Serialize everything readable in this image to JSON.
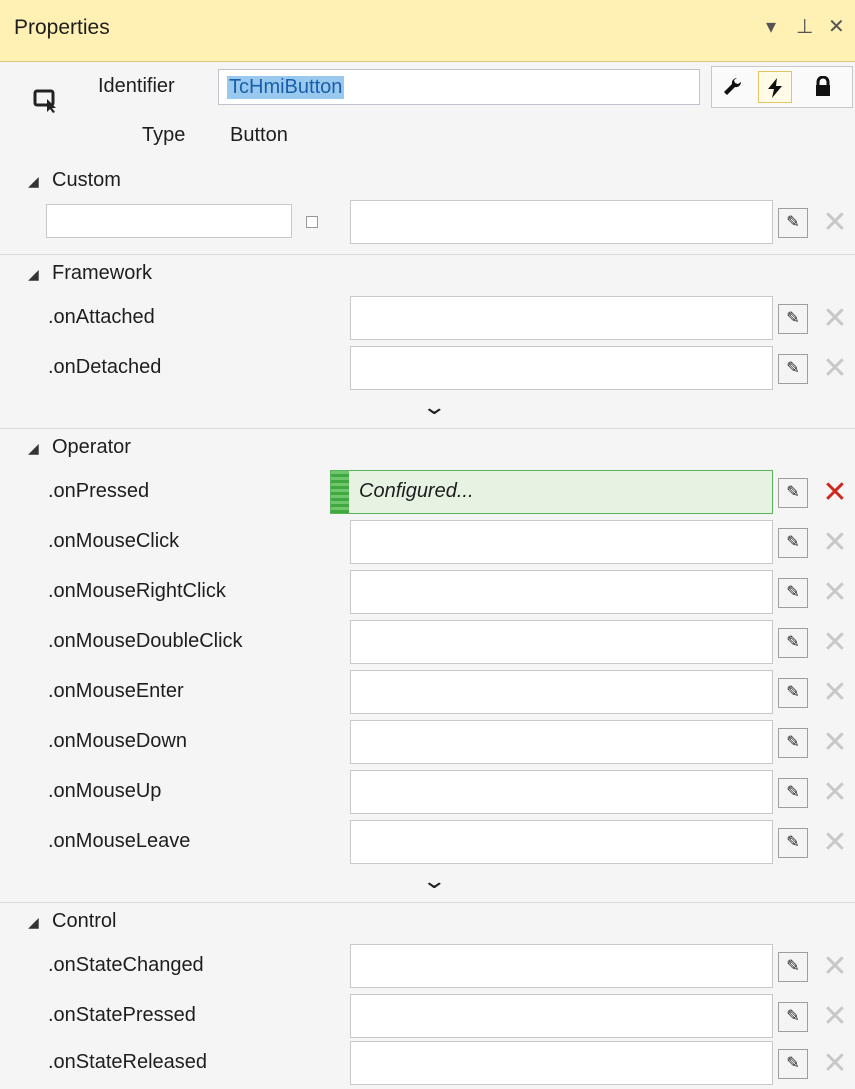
{
  "panel": {
    "title": "Properties",
    "controls": {
      "dropdown": "▾",
      "pin": "⊥",
      "close": "✕"
    }
  },
  "header": {
    "identifier_label": "Identifier",
    "identifier_value": "TcHmiButton",
    "type_label": "Type",
    "type_value": "Button",
    "tools": [
      {
        "name": "properties-wrench-icon",
        "glyph": "🔧",
        "active": false
      },
      {
        "name": "events-lightning-icon",
        "glyph": "⚡",
        "active": true
      },
      {
        "name": "lock-icon",
        "glyph": "🔒",
        "active": false
      }
    ]
  },
  "sections": {
    "custom": {
      "name": "Custom"
    },
    "framework": {
      "name": "Framework",
      "events": [
        ".onAttached",
        ".onDetached"
      ]
    },
    "operator": {
      "name": "Operator",
      "events": [
        ".onPressed",
        ".onMouseClick",
        ".onMouseRightClick",
        ".onMouseDoubleClick",
        ".onMouseEnter",
        ".onMouseDown",
        ".onMouseUp",
        ".onMouseLeave"
      ],
      "configured_text": "Configured..."
    },
    "control": {
      "name": "Control",
      "events": [
        ".onStateChanged",
        ".onStatePressed",
        ".onStateReleased"
      ]
    }
  },
  "glyphs": {
    "edit": "✎",
    "delete": "✕",
    "expand": "⌄",
    "collapse_triangle": "◢"
  }
}
